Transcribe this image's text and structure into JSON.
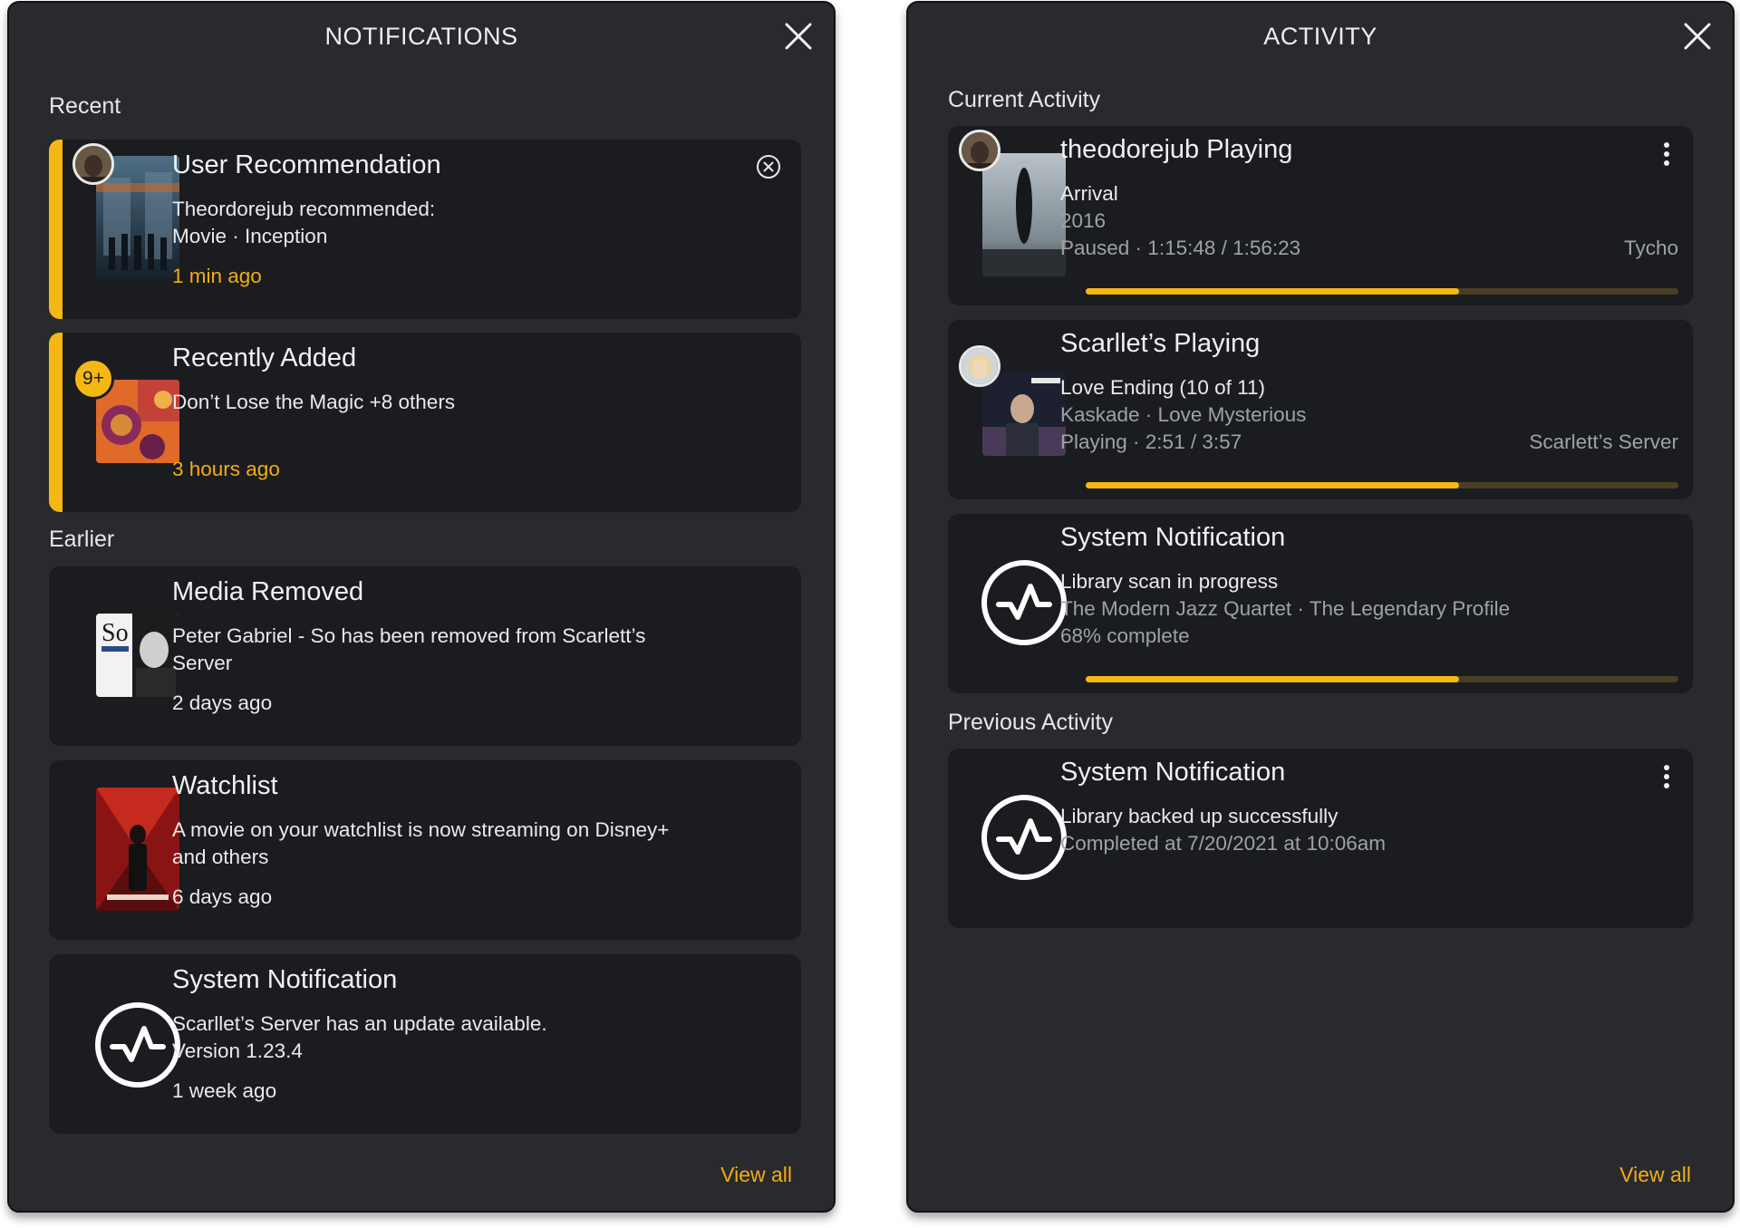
{
  "colors": {
    "accent": "#f5b713",
    "panel_bg": "#282a2e",
    "card_bg": "#1a1c1f"
  },
  "notifications": {
    "title": "NOTIFICATIONS",
    "close_icon": "close-icon",
    "recent_label": "Recent",
    "earlier_label": "Earlier",
    "view_all": "View all",
    "items": [
      {
        "title": "User Recommendation",
        "line1": "Theordorejub recommended:",
        "line2": "Movie · Inception",
        "time": "1 min ago",
        "dismiss_icon": "dismiss-circle-icon"
      },
      {
        "title": "Recently Added",
        "line1": "Don’t Lose the Magic +8 others",
        "badge": "9+",
        "time": "3 hours ago"
      },
      {
        "title": "Media Removed",
        "line1": "Peter Gabriel - So has been removed from Scarlett’s",
        "line2": "Server",
        "time": "2 days ago"
      },
      {
        "title": "Watchlist",
        "line1": "A movie on your watchlist is now streaming on Disney+",
        "line2": "and others",
        "time": "6 days ago"
      },
      {
        "title": "System Notification",
        "line1": "Scarllet’s Server has an update available.",
        "line2": "Version 1.23.4",
        "time": "1 week ago",
        "icon": "pulse-icon"
      }
    ]
  },
  "activity": {
    "title": "ACTIVITY",
    "close_icon": "close-icon",
    "current_label": "Current Activity",
    "previous_label": "Previous Activity",
    "view_all": "View all",
    "current": [
      {
        "title": "theodorejub Playing",
        "line1": "Arrival",
        "line2": "2016",
        "line3": "Paused · 1:15:48 / 1:56:23",
        "right": "Tycho",
        "progress": 0.63,
        "menu_icon": "more-vert-icon"
      },
      {
        "title": "Scarllet’s Playing",
        "line1": "Love Ending (10 of 11)",
        "line2": "Kaskade · Love Mysterious",
        "line3": "Playing · 2:51 / 3:57",
        "right": "Scarlett’s Server",
        "progress": 0.63
      },
      {
        "title": "System Notification",
        "line1": "Library scan in progress",
        "line2": "The Modern Jazz Quartet · The Legendary Profile",
        "line3": "68% complete",
        "progress": 0.63,
        "icon": "pulse-icon"
      }
    ],
    "previous": [
      {
        "title": "System Notification",
        "line1": "Library backed up successfully",
        "line2": "Completed at 7/20/2021 at 10:06am",
        "menu_icon": "more-vert-icon",
        "icon": "pulse-icon"
      }
    ]
  }
}
